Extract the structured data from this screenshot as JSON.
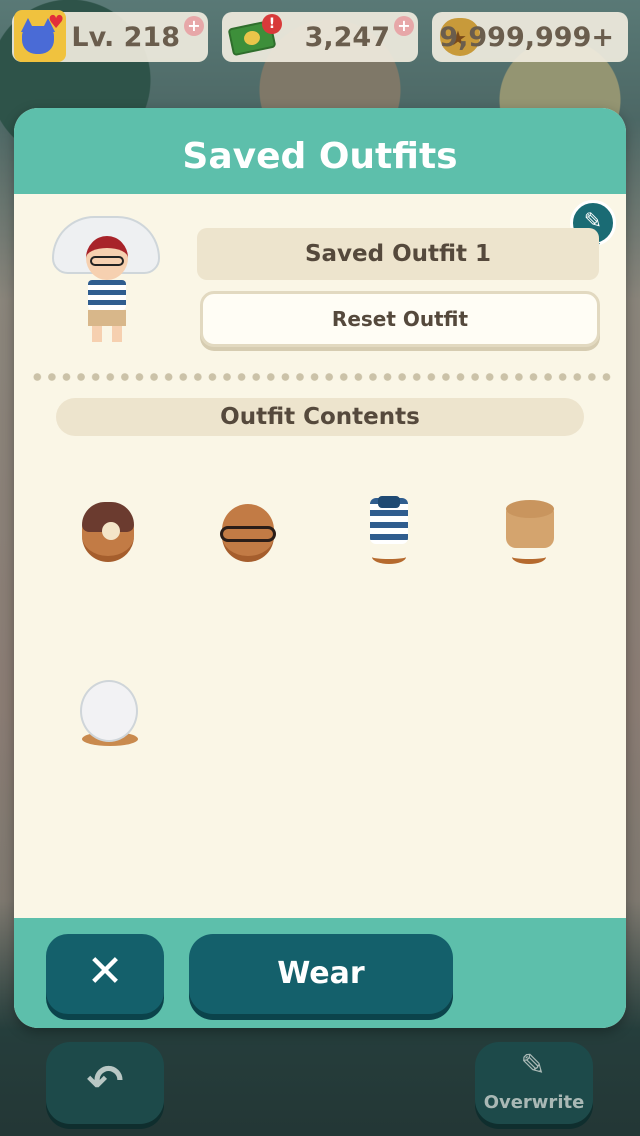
{
  "hud": {
    "level": "Lv. 218",
    "tickets": "3,247",
    "bells": "9,999,999+",
    "heart_icon": "heart-icon",
    "alert_icon": "alert-icon"
  },
  "dialog": {
    "title": "Saved Outfits",
    "outfit_name": "Saved Outfit 1",
    "reset_label": "Reset Outfit",
    "contents_label": "Outfit Contents",
    "items": [
      {
        "icon": "hat-with-flower-icon"
      },
      {
        "icon": "glasses-icon"
      },
      {
        "icon": "striped-shirt-icon"
      },
      {
        "icon": "shorts-icon"
      },
      {
        "icon": "parasol-icon"
      }
    ],
    "close_glyph": "✕",
    "wear_label": "Wear"
  },
  "bottom": {
    "back_glyph": "↶",
    "overwrite_label": "Overwrite"
  },
  "colors": {
    "header": "#5dbfab",
    "button": "#14606b",
    "panel": "#faf6e6"
  }
}
